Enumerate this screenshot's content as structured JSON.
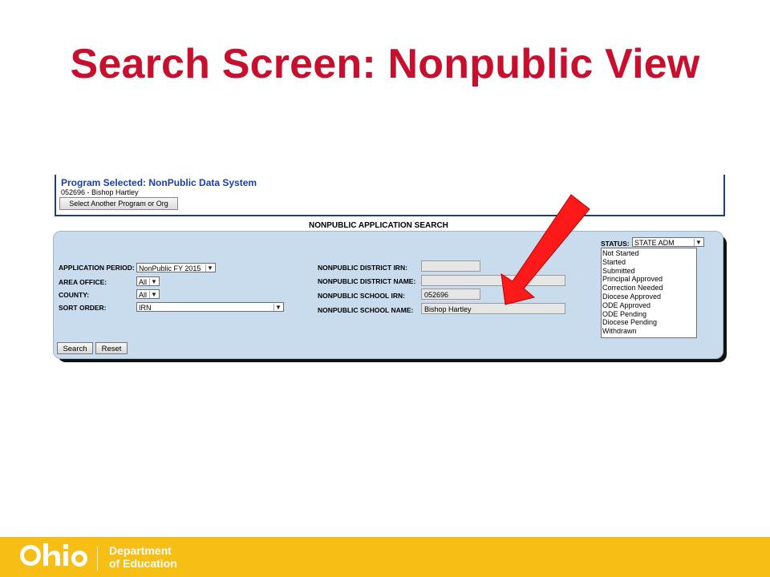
{
  "slide": {
    "title": "Search Screen: Nonpublic View"
  },
  "program": {
    "title": "Program Selected: NonPublic Data System",
    "org": "052696 - Bishop Hartley",
    "change_button": "Select Another Program or Org"
  },
  "search": {
    "heading": "NONPUBLIC APPLICATION SEARCH",
    "left_fields": [
      {
        "label": "APPLICATION PERIOD:",
        "value": "NonPublic FY 2015"
      },
      {
        "label": "AREA OFFICE:",
        "value": "All"
      },
      {
        "label": "COUNTY:",
        "value": "All"
      },
      {
        "label": "SORT ORDER:",
        "value": "IRN"
      }
    ],
    "right_fields": [
      {
        "label": "NONPUBLIC DISTRICT IRN:",
        "value": ""
      },
      {
        "label": "NONPUBLIC DISTRICT NAME:",
        "value": ""
      },
      {
        "label": "NONPUBLIC SCHOOL IRN:",
        "value": "052696"
      },
      {
        "label": "NONPUBLIC SCHOOL NAME:",
        "value": "Bishop Hartley"
      }
    ],
    "status": {
      "label": "STATUS:",
      "selected": "STATE ADM",
      "options": [
        "Not Started",
        "Started",
        "Submitted",
        "Principal Approved",
        "Correction Needed",
        "Diocese Approved",
        "ODE Approved",
        "ODE Pending",
        "Diocese Pending",
        "Withdrawn"
      ]
    },
    "search_button": "Search",
    "reset_button": "Reset"
  },
  "footer": {
    "logo_text": "Ohio",
    "dept_line1": "Department",
    "dept_line2": "of Education"
  },
  "colors": {
    "title_red": "#c8102e",
    "panel_blue": "#c9dcee",
    "footer_gold": "#f7be16",
    "arrow_red": "#ff1a1a"
  }
}
